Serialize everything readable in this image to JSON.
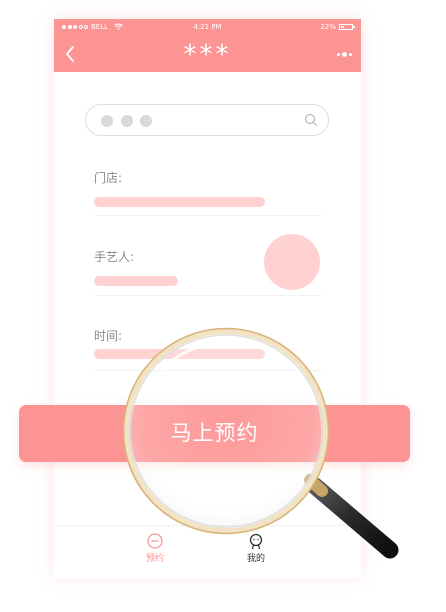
{
  "status_bar": {
    "carrier": "BELL",
    "time": "4:21 PM",
    "battery": "22%"
  },
  "nav": {
    "title": "***",
    "back_icon": "chevron-left-icon",
    "more_icon": "more-dots-icon"
  },
  "search": {
    "placeholder_dots": 3,
    "icon": "search-icon"
  },
  "fields": [
    {
      "label": "门店:"
    },
    {
      "label": "手艺人:"
    },
    {
      "label": "时间:"
    }
  ],
  "cta": {
    "label": "马上预约"
  },
  "tabs": [
    {
      "label": "预约",
      "icon": "booking-icon",
      "active": true
    },
    {
      "label": "我的",
      "icon": "user-icon",
      "active": false
    }
  ],
  "colors": {
    "accent": "#fd9494",
    "placeholder_fill": "#ffd1d1",
    "tab_inactive": "#333333"
  }
}
